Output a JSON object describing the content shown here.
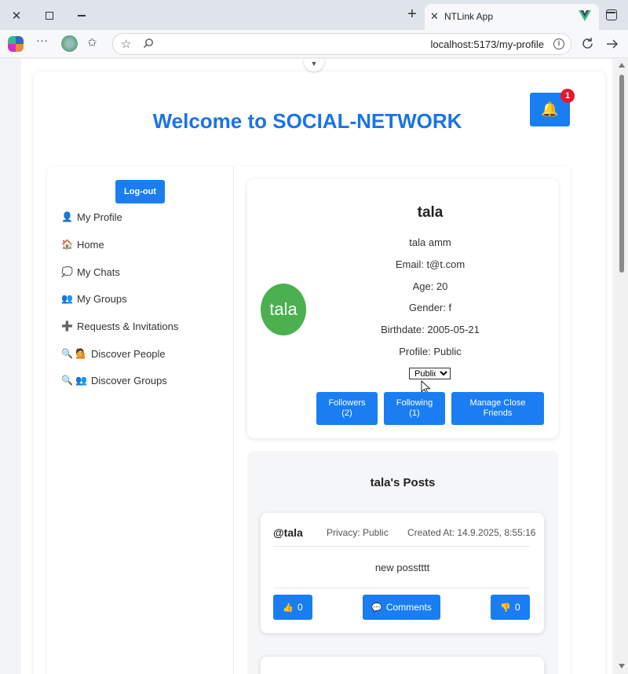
{
  "browser": {
    "tab_title": "NTLink App",
    "url": "localhost:5173/my-profile",
    "new_tab": "+",
    "tab_close": "✕"
  },
  "page": {
    "welcome": "Welcome to SOCIAL-NETWORK",
    "notification_count": "1"
  },
  "sidebar": {
    "logout_label": "Log-out",
    "items": [
      {
        "label": "My Profile",
        "icon": "👤"
      },
      {
        "label": "Home",
        "icon": "🏠"
      },
      {
        "label": "My Chats",
        "icon": "💭"
      },
      {
        "label": "My Groups",
        "icon": "👥"
      },
      {
        "label": "Requests & Invitations",
        "icon": "➕"
      },
      {
        "label": "Discover People",
        "icon": "🔍 💁"
      },
      {
        "label": "Discover Groups",
        "icon": "🔍 👥"
      }
    ]
  },
  "profile": {
    "avatar_text": "tala",
    "nickname": "tala",
    "full_name": "tala amm",
    "email": "Email: t@t.com",
    "age": "Age: 20",
    "gender": "Gender: f",
    "birthdate": "Birthdate: 2005-05-21",
    "profile_privacy": "Profile: Public",
    "privacy_select_value": "Public",
    "followers_label": "Followers",
    "followers_count": "(2)",
    "following_label": "Following",
    "following_count": "(1)",
    "manage_label_1": "Manage Close",
    "manage_label_2": "Friends"
  },
  "posts": {
    "title": "tala's Posts",
    "items": [
      {
        "user": "@tala",
        "privacy": "Privacy: Public",
        "created": "Created At: 14.9.2025, 8:55:16",
        "body": "new posstttt",
        "likes": "0",
        "comments_label": "Comments",
        "dislikes": "0"
      }
    ]
  },
  "colors": {
    "accent": "#1a7ef2",
    "title": "#1a73e8",
    "avatar": "#4caf50",
    "badge": "#e3192b"
  }
}
